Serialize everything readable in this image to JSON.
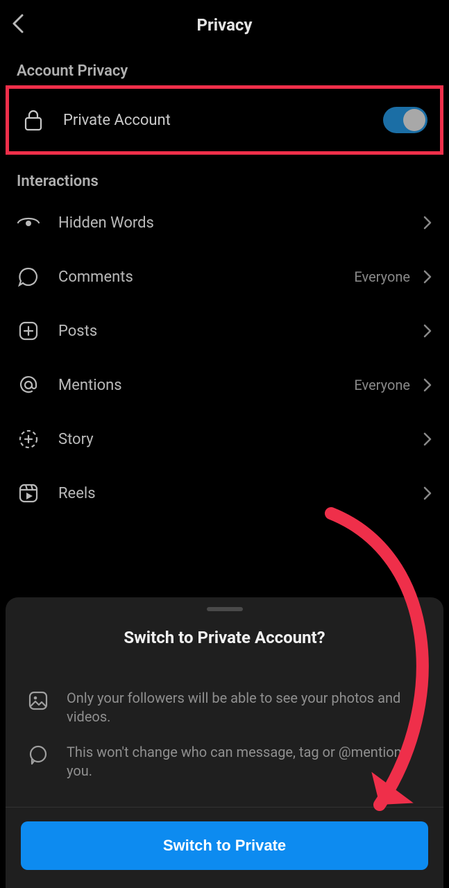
{
  "header": {
    "title": "Privacy"
  },
  "section_account": {
    "header": "Account Privacy",
    "private_account_label": "Private Account",
    "private_account_on": true
  },
  "section_interactions": {
    "header": "Interactions",
    "items": [
      {
        "icon": "hidden-words-icon",
        "label": "Hidden Words",
        "value": ""
      },
      {
        "icon": "comment-icon",
        "label": "Comments",
        "value": "Everyone"
      },
      {
        "icon": "plus-square-icon",
        "label": "Posts",
        "value": ""
      },
      {
        "icon": "at-icon",
        "label": "Mentions",
        "value": "Everyone"
      },
      {
        "icon": "story-icon",
        "label": "Story",
        "value": ""
      },
      {
        "icon": "reels-icon",
        "label": "Reels",
        "value": ""
      }
    ]
  },
  "sheet": {
    "title": "Switch to Private Account?",
    "bullets": [
      {
        "icon": "photo-icon",
        "text": "Only your followers will be able to see your photos and videos."
      },
      {
        "icon": "comment-icon",
        "text": "This won't change who can message, tag or @mention you."
      }
    ],
    "primary": "Switch to Private"
  },
  "annotation": {
    "highlight_color": "#ef2f4a",
    "arrow_color": "#ef2f4a"
  }
}
